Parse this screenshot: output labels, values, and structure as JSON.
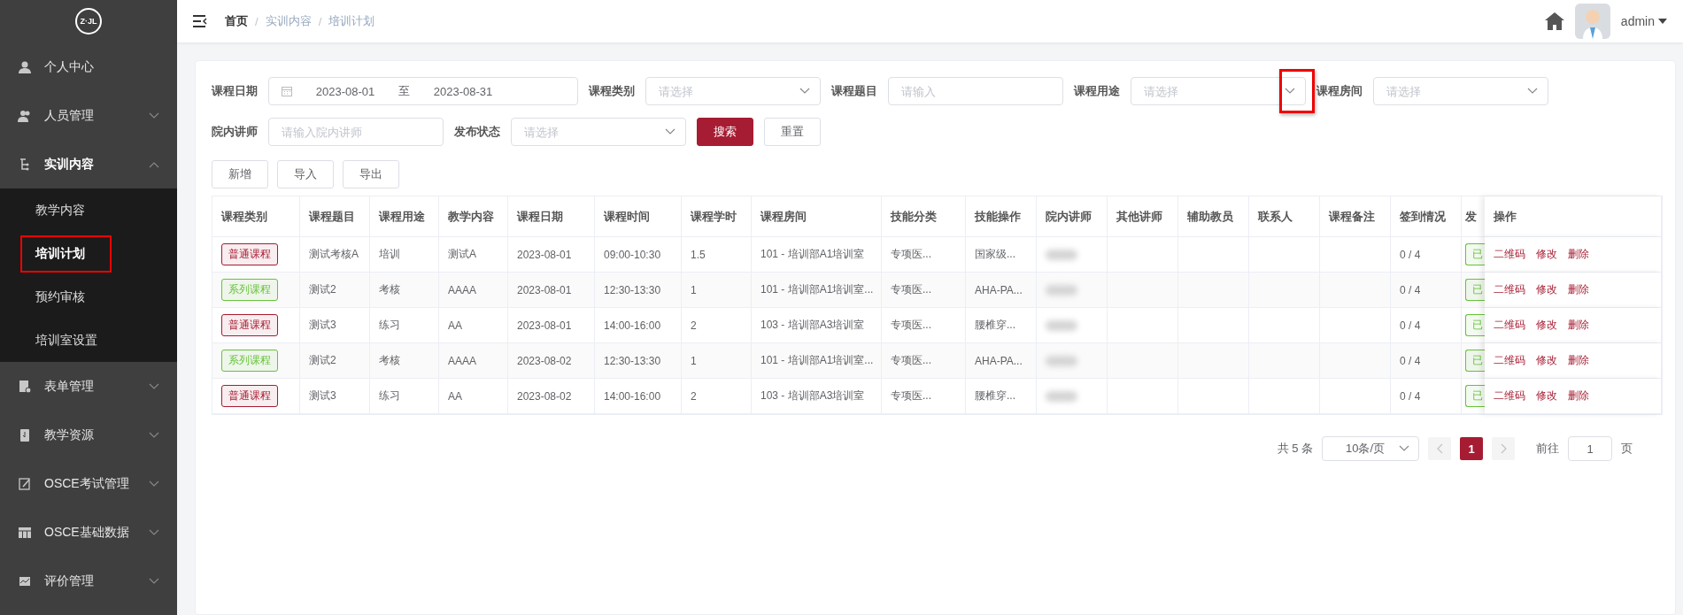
{
  "sidebar": {
    "logo": "Z·JL",
    "items": [
      {
        "label": "个人中心",
        "expanded": false,
        "has_children": false
      },
      {
        "label": "人员管理",
        "expanded": false,
        "has_children": true
      },
      {
        "label": "实训内容",
        "expanded": true,
        "has_children": true,
        "children": [
          {
            "label": "教学内容",
            "selected": false,
            "highlighted": false
          },
          {
            "label": "培训计划",
            "selected": true,
            "highlighted": true
          },
          {
            "label": "预约审核",
            "selected": false,
            "highlighted": false
          },
          {
            "label": "培训室设置",
            "selected": false,
            "highlighted": false
          }
        ]
      },
      {
        "label": "表单管理",
        "expanded": false,
        "has_children": true
      },
      {
        "label": "教学资源",
        "expanded": false,
        "has_children": true
      },
      {
        "label": "OSCE考试管理",
        "expanded": false,
        "has_children": true
      },
      {
        "label": "OSCE基础数据",
        "expanded": false,
        "has_children": true
      },
      {
        "label": "评价管理",
        "expanded": false,
        "has_children": true
      }
    ]
  },
  "header": {
    "breadcrumb": [
      "首页",
      "实训内容",
      "培训计划"
    ],
    "separators": [
      "/",
      "/"
    ],
    "user": "admin"
  },
  "filters": [
    {
      "kind": "daterange",
      "label": "课程日期",
      "start": "2023-08-01",
      "separator": "至",
      "end": "2023-08-31"
    },
    {
      "kind": "select",
      "label": "课程类别",
      "placeholder": "请选择",
      "highlighted": false
    },
    {
      "kind": "input",
      "label": "课程题目",
      "placeholder": "请输入"
    },
    {
      "kind": "select",
      "label": "课程用途",
      "placeholder": "请选择",
      "highlighted": true
    },
    {
      "kind": "select",
      "label": "课程房间",
      "placeholder": "请选择",
      "highlighted": false
    },
    {
      "kind": "input",
      "label": "院内讲师",
      "placeholder": "请输入院内讲师"
    },
    {
      "kind": "select",
      "label": "发布状态",
      "placeholder": "请选择",
      "highlighted": false
    }
  ],
  "filter_buttons": [
    {
      "label": "搜索",
      "kind": "primary"
    },
    {
      "label": "重置",
      "kind": "plain"
    }
  ],
  "toolbar": [
    "新增",
    "导入",
    "导出"
  ],
  "table": {
    "columns": [
      "课程类别",
      "课程题目",
      "课程用途",
      "教学内容",
      "课程日期",
      "课程时间",
      "课程学时",
      "课程房间",
      "技能分类",
      "技能操作",
      "院内讲师",
      "其他讲师",
      "辅助教员",
      "联系人",
      "课程备注",
      "签到情况",
      "发",
      "操作"
    ],
    "rows": [
      {
        "category": {
          "text": "普通课程",
          "color": "#a61c32"
        },
        "title": "测试考核A",
        "purpose": "培训",
        "content": "测试A",
        "date": "2023-08-01",
        "time": "09:00-10:30",
        "hours": "1.5",
        "room": "101 - 培训部A1培训室",
        "skill_category": "专项医...",
        "skill_operation": "国家级...",
        "sign_in": "0 / 4",
        "status": {
          "text": "已",
          "color": "#67c23a"
        },
        "actions": [
          "二维码",
          "修改",
          "删除"
        ]
      },
      {
        "category": {
          "text": "系列课程",
          "color": "#67c23a"
        },
        "title": "测试2",
        "purpose": "考核",
        "content": "AAAA",
        "date": "2023-08-01",
        "time": "12:30-13:30",
        "hours": "1",
        "room": "101 - 培训部A1培训室...",
        "skill_category": "专项医...",
        "skill_operation": "AHA-PA...",
        "sign_in": "0 / 4",
        "status": {
          "text": "已",
          "color": "#67c23a"
        },
        "actions": [
          "二维码",
          "修改",
          "删除"
        ]
      },
      {
        "category": {
          "text": "普通课程",
          "color": "#a61c32"
        },
        "title": "测试3",
        "purpose": "练习",
        "content": "AA",
        "date": "2023-08-01",
        "time": "14:00-16:00",
        "hours": "2",
        "room": "103 - 培训部A3培训室",
        "skill_category": "专项医...",
        "skill_operation": "腰椎穿...",
        "sign_in": "0 / 4",
        "status": {
          "text": "已",
          "color": "#67c23a"
        },
        "actions": [
          "二维码",
          "修改",
          "删除"
        ]
      },
      {
        "category": {
          "text": "系列课程",
          "color": "#67c23a"
        },
        "title": "测试2",
        "purpose": "考核",
        "content": "AAAA",
        "date": "2023-08-02",
        "time": "12:30-13:30",
        "hours": "1",
        "room": "101 - 培训部A1培训室...",
        "skill_category": "专项医...",
        "skill_operation": "AHA-PA...",
        "sign_in": "0 / 4",
        "status": {
          "text": "已",
          "color": "#67c23a"
        },
        "actions": [
          "二维码",
          "修改",
          "删除"
        ]
      },
      {
        "category": {
          "text": "普通课程",
          "color": "#a61c32"
        },
        "title": "测试3",
        "purpose": "练习",
        "content": "AA",
        "date": "2023-08-02",
        "time": "14:00-16:00",
        "hours": "2",
        "room": "103 - 培训部A3培训室",
        "skill_category": "专项医...",
        "skill_operation": "腰椎穿...",
        "sign_in": "0 / 4",
        "status": {
          "text": "已",
          "color": "#67c23a"
        },
        "actions": [
          "二维码",
          "修改",
          "删除"
        ]
      }
    ]
  },
  "pagination": {
    "total": "共 5 条",
    "page_size": "10条/页",
    "pages": [
      {
        "label": "1",
        "selected": true
      }
    ],
    "goto_label": "前往",
    "goto_value": "1",
    "goto_suffix": "页"
  }
}
